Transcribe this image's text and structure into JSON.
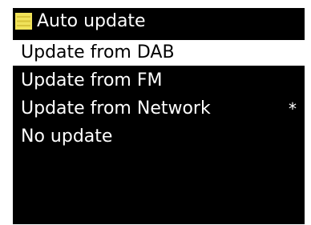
{
  "header": {
    "title": "Auto update",
    "icon": "menu-list-icon",
    "icon_color": "#f0e25a"
  },
  "menu": {
    "items": [
      {
        "label": "Update from DAB",
        "selected": true,
        "marker": ""
      },
      {
        "label": "Update from FM",
        "selected": false,
        "marker": ""
      },
      {
        "label": "Update from Network",
        "selected": false,
        "marker": "*"
      },
      {
        "label": "No update",
        "selected": false,
        "marker": ""
      }
    ]
  },
  "colors": {
    "screen_background": "#000000",
    "text": "#ffffff",
    "selection_background": "#ffffff",
    "selection_text": "#000000"
  }
}
